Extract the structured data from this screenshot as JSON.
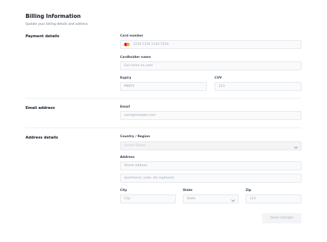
{
  "header": {
    "title": "Billing Information",
    "subtitle": "Update your billing details and address"
  },
  "payment": {
    "section_label": "Payment details",
    "card_number": {
      "label": "Card number",
      "placeholder": "1234 1234 1234 1234",
      "icon": "mastercard-icon"
    },
    "cardholder": {
      "label": "Cardholder name",
      "placeholder": "Full name on card"
    },
    "expiry": {
      "label": "Expiry",
      "placeholder": "MM/YY"
    },
    "cvv": {
      "label": "CVV",
      "placeholder": "123"
    }
  },
  "email": {
    "section_label": "Email address",
    "label": "Email",
    "placeholder": "user@example.com"
  },
  "address": {
    "section_label": "Address details",
    "country": {
      "label": "Country / Region",
      "value": "United States"
    },
    "street": {
      "label": "Address",
      "placeholder": "Street address"
    },
    "apartment": {
      "placeholder": "Apartment, suite, etc (optional)"
    },
    "city": {
      "label": "City",
      "placeholder": "City"
    },
    "state": {
      "label": "State",
      "value": "State"
    },
    "zip": {
      "label": "Zip",
      "placeholder": "123"
    }
  },
  "actions": {
    "save_label": "Save changes"
  },
  "colors": {
    "input_bg": "#f9fafb",
    "border": "#e5e7eb",
    "disabled_text": "#b0b6bf"
  }
}
